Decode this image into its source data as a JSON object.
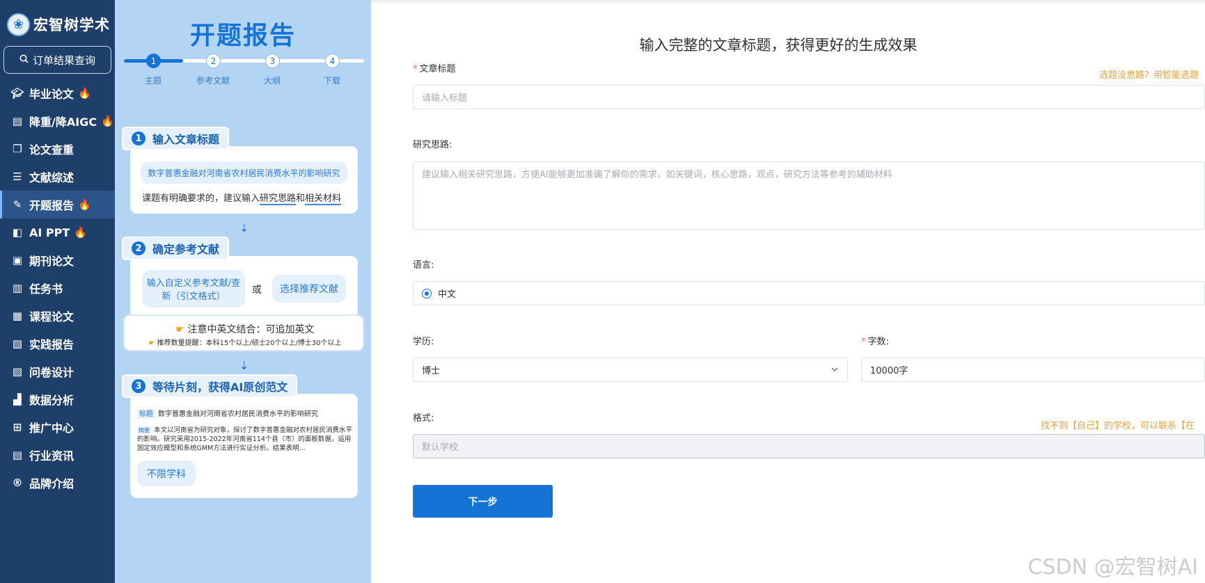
{
  "sidebar": {
    "brand": "宏智树学术",
    "order_query": "订单结果查询",
    "items": [
      {
        "label": "毕业论文",
        "hot": true
      },
      {
        "label": "降重/降AIGC",
        "hot": true
      },
      {
        "label": "论文查重",
        "hot": false
      },
      {
        "label": "文献综述",
        "hot": false
      },
      {
        "label": "开题报告",
        "hot": true
      },
      {
        "label": "AI PPT",
        "hot": true
      },
      {
        "label": "期刊论文",
        "hot": false
      },
      {
        "label": "任务书",
        "hot": false
      },
      {
        "label": "课程论文",
        "hot": false
      },
      {
        "label": "实践报告",
        "hot": false
      },
      {
        "label": "问卷设计",
        "hot": false
      },
      {
        "label": "数据分析",
        "hot": false
      },
      {
        "label": "推广中心",
        "hot": false
      },
      {
        "label": "行业资讯",
        "hot": false
      },
      {
        "label": "品牌介绍",
        "hot": false
      }
    ],
    "active_index": 4
  },
  "guide": {
    "title": "开题报告",
    "steps": [
      {
        "num": "1",
        "label": "主题"
      },
      {
        "num": "2",
        "label": "参考文献"
      },
      {
        "num": "3",
        "label": "大纲"
      },
      {
        "num": "4",
        "label": "下载"
      }
    ],
    "current_step": 1,
    "card1": {
      "num": "1",
      "head": "输入文章标题",
      "example": "数字普惠金融对河南省农村居民消费水平的影响研究",
      "tip_prefix": "课题有明确要求的，建议输入",
      "tip_link1": "研究思路",
      "tip_and": "和",
      "tip_link2": "相关材料"
    },
    "card2": {
      "num": "2",
      "head": "确定参考文献",
      "option1": "输入自定义参考文献/查新（引文格式）",
      "or": "或",
      "option2": "选择推荐文献",
      "note_title": "注意中英文结合：可追加英文",
      "note_sub": "推荐数量提醒：本科15个以上/硕士20个以上/博士30个以上"
    },
    "card3": {
      "num": "3",
      "head": "等待片刻，获得AI原创范文",
      "tag_title": "标题",
      "title_text": "数字普惠金融对河南省农村居民消费水平的影响研究",
      "tag_abstract": "摘要",
      "abstract_text": "本文以河南省为研究对象，探讨了数字普惠金融对农村居民消费水平的影响。研究采用2015-2022年河南省114个县（市）的面板数据，运用固定效应模型和系统GMM方法进行实证分析。结果表明...",
      "subject_pill": "不限学科"
    }
  },
  "form": {
    "heading": "输入完整的文章标题，获得更好的生成效果",
    "title_label": "文章标题",
    "title_hint": "选题没思路？用智能选题",
    "title_placeholder": "请输入标题",
    "research_label": "研究思路:",
    "research_placeholder": "建议输入相关研究思路，方便AI能够更加准确了解你的需求，如关键词，核心思路，观点，研究方法等参考的辅助材料",
    "language_label": "语言:",
    "language_value": "中文",
    "education_label": "学历:",
    "education_value": "博士",
    "words_label": "字数:",
    "words_value": "10000字",
    "format_label": "格式:",
    "format_hint": "找不到【自己】的学校，可以联系【在",
    "format_placeholder": "默认学校",
    "next_button": "下一步"
  },
  "watermark": "CSDN @宏智树AI"
}
